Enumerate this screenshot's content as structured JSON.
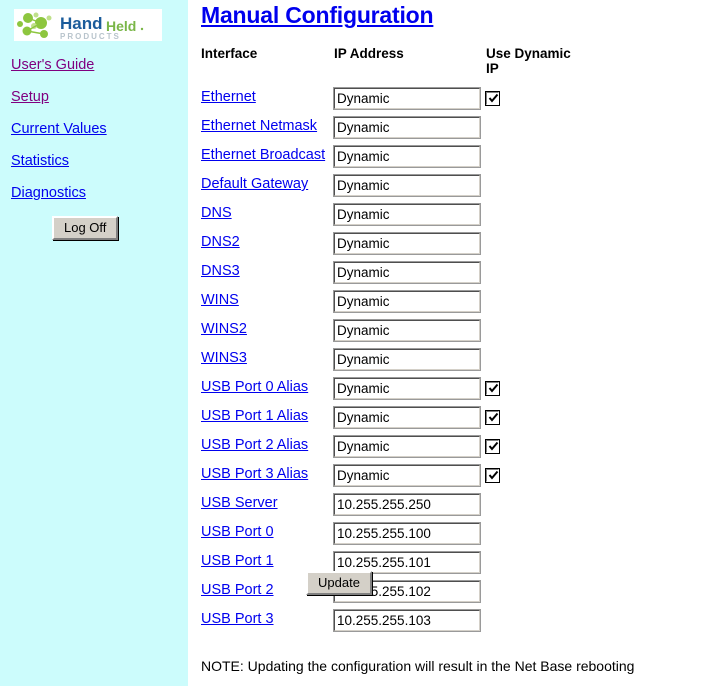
{
  "sidebar": {
    "logo": {
      "name": "handheld-products-logo",
      "text_hand": "Hand",
      "text_held": "Held",
      "text_products": "PRODUCTS",
      "color_hand": "#1b5c9b",
      "color_held": "#7ab648",
      "color_dots": "#8dc63f",
      "color_dots_light": "#bfe08a"
    },
    "nav": [
      {
        "label": "User's Guide",
        "state": "visited"
      },
      {
        "label": "Setup",
        "state": "visited"
      },
      {
        "label": "Current Values",
        "state": "unvisited"
      },
      {
        "label": "Statistics",
        "state": "unvisited"
      },
      {
        "label": "Diagnostics",
        "state": "unvisited"
      }
    ],
    "logoff_label": "Log Off",
    "background_color": "#ccfcfc"
  },
  "main": {
    "title": "Manual Configuration",
    "title_color": "#0000ee",
    "headers": {
      "interface": "Interface",
      "ip_address": "IP Address",
      "use_dynamic_ip": "Use Dynamic IP"
    },
    "rows": [
      {
        "interface": "Ethernet",
        "ip": "Dynamic",
        "has_checkbox": true,
        "checked": true
      },
      {
        "interface": "Ethernet Netmask",
        "ip": "Dynamic",
        "has_checkbox": false,
        "checked": false
      },
      {
        "interface": "Ethernet Broadcast",
        "ip": "Dynamic",
        "has_checkbox": false,
        "checked": false
      },
      {
        "interface": "Default Gateway",
        "ip": "Dynamic",
        "has_checkbox": false,
        "checked": false
      },
      {
        "interface": "DNS",
        "ip": "Dynamic",
        "has_checkbox": false,
        "checked": false
      },
      {
        "interface": "DNS2",
        "ip": "Dynamic",
        "has_checkbox": false,
        "checked": false
      },
      {
        "interface": "DNS3",
        "ip": "Dynamic",
        "has_checkbox": false,
        "checked": false
      },
      {
        "interface": "WINS",
        "ip": "Dynamic",
        "has_checkbox": false,
        "checked": false
      },
      {
        "interface": "WINS2",
        "ip": "Dynamic",
        "has_checkbox": false,
        "checked": false
      },
      {
        "interface": "WINS3",
        "ip": "Dynamic",
        "has_checkbox": false,
        "checked": false
      },
      {
        "interface": "USB Port 0 Alias",
        "ip": "Dynamic",
        "has_checkbox": true,
        "checked": true
      },
      {
        "interface": "USB Port 1 Alias",
        "ip": "Dynamic",
        "has_checkbox": true,
        "checked": true
      },
      {
        "interface": "USB Port 2 Alias",
        "ip": "Dynamic",
        "has_checkbox": true,
        "checked": true
      },
      {
        "interface": "USB Port 3 Alias",
        "ip": "Dynamic",
        "has_checkbox": true,
        "checked": true
      },
      {
        "interface": "USB Server",
        "ip": "10.255.255.250",
        "has_checkbox": false,
        "checked": false
      },
      {
        "interface": "USB Port 0",
        "ip": "10.255.255.100",
        "has_checkbox": false,
        "checked": false
      },
      {
        "interface": "USB Port 1",
        "ip": "10.255.255.101",
        "has_checkbox": false,
        "checked": false
      },
      {
        "interface": "USB Port 2",
        "ip": "10.255.255.102",
        "has_checkbox": false,
        "checked": false
      },
      {
        "interface": "USB Port 3",
        "ip": "10.255.255.103",
        "has_checkbox": false,
        "checked": false
      }
    ],
    "update_label": "Update",
    "note": "NOTE: Updating the configuration will result in the Net Base rebooting"
  }
}
